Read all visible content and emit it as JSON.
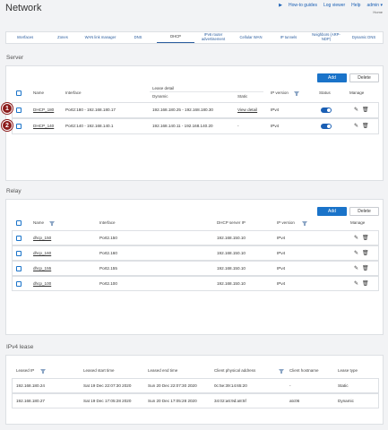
{
  "header": {
    "title": "Network",
    "links": {
      "guides": "How-to guides",
      "log": "Log viewer",
      "help": "Help",
      "admin": "admin ▾"
    },
    "sub": "Home"
  },
  "tabs": [
    "Interfaces",
    "Zones",
    "WAN link manager",
    "DNS",
    "DHCP",
    "IPv6 router advertisement",
    "Cellular WAN",
    "IP tunnels",
    "Neighbors (ARP-NDP)",
    "Dynamic DNS"
  ],
  "server": {
    "title": "Server",
    "add": "Add",
    "delete": "Delete",
    "headers": {
      "name": "Name",
      "interface": "Interface",
      "lease": "Lease detail",
      "dynamic": "Dynamic",
      "static": "Static",
      "ipver": "IP version",
      "status": "Status",
      "manage": "Manage"
    },
    "rows": [
      {
        "marker": "1",
        "name": "DHCP_180",
        "interface": "Port2:180 - 192.168.180.17",
        "dynamic": "192.168.180.25 - 192.168.180.30",
        "static": "View detail",
        "ipver": "IPv4"
      },
      {
        "marker": "2",
        "name": "DHCP_140",
        "interface": "Port2:140 - 192.168.140.1",
        "dynamic": "192.168.140.11 - 192.168.140.20",
        "static": "-",
        "ipver": "IPv4"
      }
    ]
  },
  "relay": {
    "title": "Relay",
    "add": "Add",
    "delete": "Delete",
    "headers": {
      "name": "Name",
      "interface": "Interface",
      "dhcp": "DHCP server IP",
      "ipver": "IP version",
      "manage": "Manage"
    },
    "rows": [
      {
        "name": "dhcp_150",
        "interface": "Port2.150",
        "dhcp": "192.168.150.10",
        "ipver": "IPv4"
      },
      {
        "name": "dhcp_160",
        "interface": "Port2.160",
        "dhcp": "192.168.150.10",
        "ipver": "IPv4"
      },
      {
        "name": "dhcp_155",
        "interface": "Port2.155",
        "dhcp": "192.168.150.10",
        "ipver": "IPv4"
      },
      {
        "name": "dhcp_100",
        "interface": "Port2.100",
        "dhcp": "192.168.150.10",
        "ipver": "IPv4"
      }
    ]
  },
  "lease": {
    "title": "IPv4 lease",
    "headers": {
      "ip": "Leased IP",
      "start": "Leased start time",
      "end": "Leased end time",
      "mac": "Client physical address",
      "host": "Client hostname",
      "type": "Lease type"
    },
    "rows": [
      {
        "ip": "192.168.180.24",
        "start": "Sat 19 Dec 22:07:30 2020",
        "end": "Sun 20 Dec 22:07:30 2020",
        "mac": "0c:5e:39:14:65:20",
        "host": "-",
        "type": "Static"
      },
      {
        "ip": "192.168.180.27",
        "start": "Sat 19 Dec 17:05:28 2020",
        "end": "Sun 20 Dec 17:05:28 2020",
        "mac": "34:02:a6:9d:a8:5f",
        "host": "atc06",
        "type": "Dynamic"
      }
    ]
  }
}
